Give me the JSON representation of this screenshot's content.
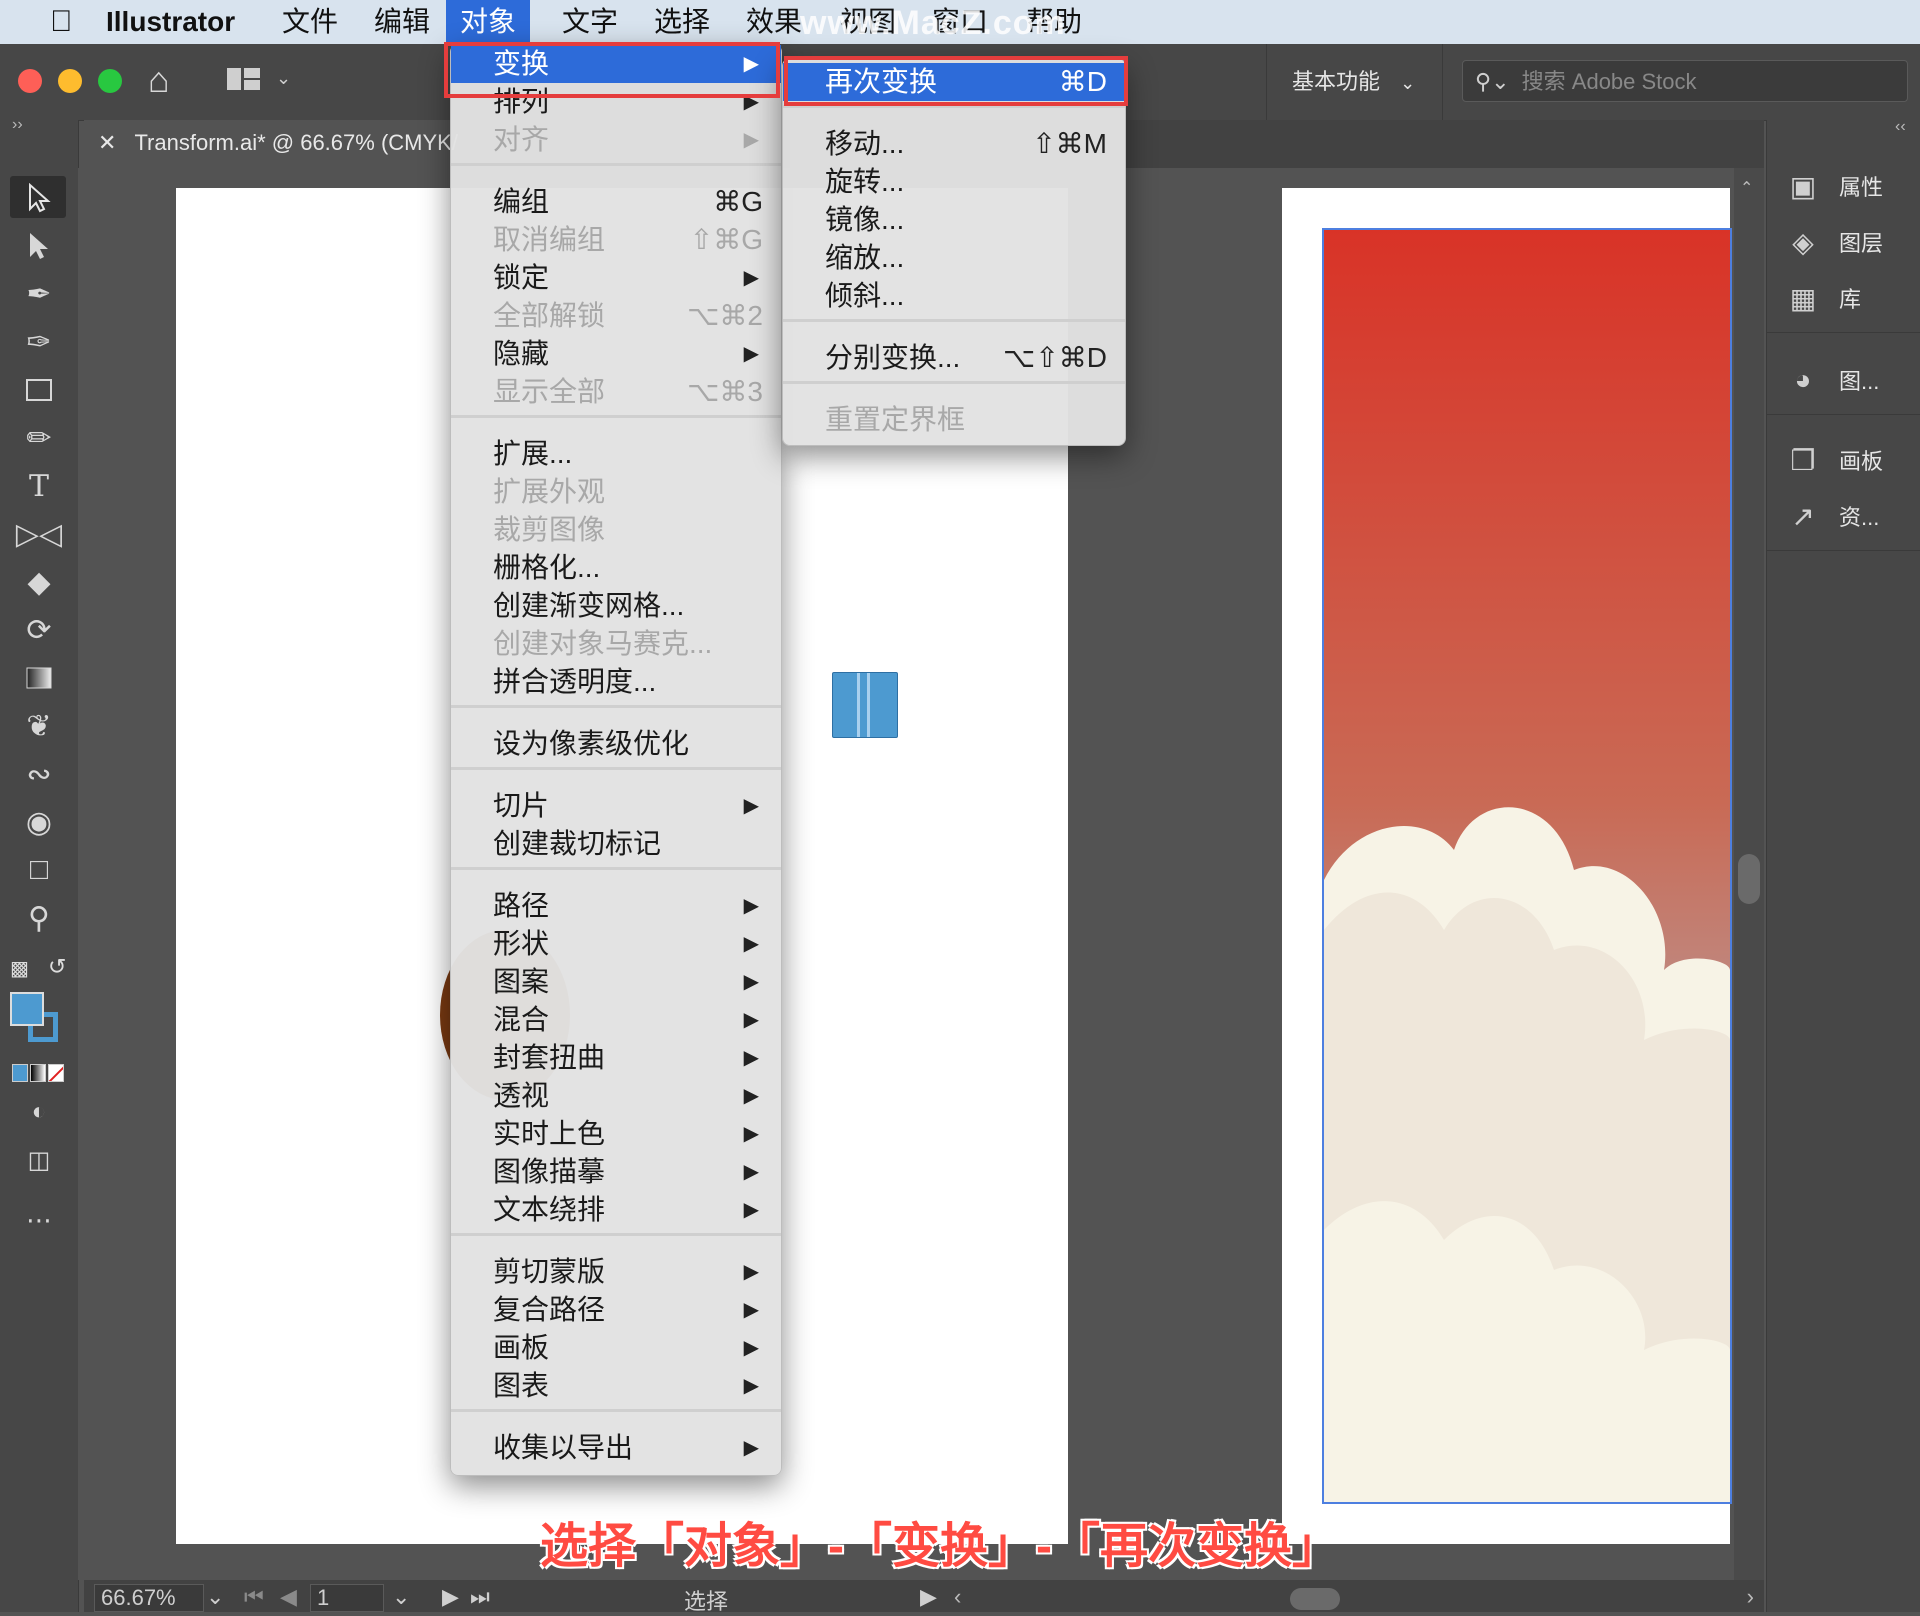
{
  "menubar": {
    "items": [
      "Illustrator",
      "文件",
      "编辑",
      "对象",
      "文字",
      "选择",
      "效果",
      "视图",
      "窗口",
      "帮助"
    ],
    "active": "对象"
  },
  "watermark": "www.MacZ.com",
  "controlbar": {
    "workspace": "基本功能",
    "search_placeholder": "搜索 Adobe Stock"
  },
  "tab": {
    "title": "Transform.ai* @ 66.67% (CMYK/"
  },
  "right_panel": {
    "items": [
      {
        "label": "属性",
        "icon": "properties-icon"
      },
      {
        "label": "图层",
        "icon": "layers-icon"
      },
      {
        "label": "库",
        "icon": "libraries-icon"
      },
      {
        "label": "图...",
        "icon": "appearance-icon"
      },
      {
        "label": "画板",
        "icon": "artboards-icon"
      },
      {
        "label": "资...",
        "icon": "asset-export-icon"
      }
    ]
  },
  "object_menu": {
    "items": [
      {
        "label": "变换",
        "shortcut": "",
        "submenu": true,
        "disabled": false,
        "highlighted": true
      },
      {
        "label": "排列",
        "shortcut": "",
        "submenu": true,
        "disabled": false
      },
      {
        "label": "对齐",
        "shortcut": "",
        "submenu": true,
        "disabled": true
      },
      {
        "sep": true
      },
      {
        "label": "编组",
        "shortcut": "⌘G",
        "submenu": false,
        "disabled": false
      },
      {
        "label": "取消编组",
        "shortcut": "⇧⌘G",
        "submenu": false,
        "disabled": true
      },
      {
        "label": "锁定",
        "shortcut": "",
        "submenu": true,
        "disabled": false
      },
      {
        "label": "全部解锁",
        "shortcut": "⌥⌘2",
        "submenu": false,
        "disabled": true
      },
      {
        "label": "隐藏",
        "shortcut": "",
        "submenu": true,
        "disabled": false
      },
      {
        "label": "显示全部",
        "shortcut": "⌥⌘3",
        "submenu": false,
        "disabled": true
      },
      {
        "sep": true
      },
      {
        "label": "扩展...",
        "shortcut": "",
        "submenu": false,
        "disabled": false
      },
      {
        "label": "扩展外观",
        "shortcut": "",
        "submenu": false,
        "disabled": true
      },
      {
        "label": "裁剪图像",
        "shortcut": "",
        "submenu": false,
        "disabled": true
      },
      {
        "label": "栅格化...",
        "shortcut": "",
        "submenu": false,
        "disabled": false
      },
      {
        "label": "创建渐变网格...",
        "shortcut": "",
        "submenu": false,
        "disabled": false
      },
      {
        "label": "创建对象马赛克...",
        "shortcut": "",
        "submenu": false,
        "disabled": true
      },
      {
        "label": "拼合透明度...",
        "shortcut": "",
        "submenu": false,
        "disabled": false
      },
      {
        "sep": true
      },
      {
        "label": "设为像素级优化",
        "shortcut": "",
        "submenu": false,
        "disabled": false
      },
      {
        "sep": true
      },
      {
        "label": "切片",
        "shortcut": "",
        "submenu": true,
        "disabled": false
      },
      {
        "label": "创建裁切标记",
        "shortcut": "",
        "submenu": false,
        "disabled": false
      },
      {
        "sep": true
      },
      {
        "label": "路径",
        "shortcut": "",
        "submenu": true,
        "disabled": false
      },
      {
        "label": "形状",
        "shortcut": "",
        "submenu": true,
        "disabled": false
      },
      {
        "label": "图案",
        "shortcut": "",
        "submenu": true,
        "disabled": false
      },
      {
        "label": "混合",
        "shortcut": "",
        "submenu": true,
        "disabled": false
      },
      {
        "label": "封套扭曲",
        "shortcut": "",
        "submenu": true,
        "disabled": false
      },
      {
        "label": "透视",
        "shortcut": "",
        "submenu": true,
        "disabled": false
      },
      {
        "label": "实时上色",
        "shortcut": "",
        "submenu": true,
        "disabled": false
      },
      {
        "label": "图像描摹",
        "shortcut": "",
        "submenu": true,
        "disabled": false
      },
      {
        "label": "文本绕排",
        "shortcut": "",
        "submenu": true,
        "disabled": false
      },
      {
        "sep": true
      },
      {
        "label": "剪切蒙版",
        "shortcut": "",
        "submenu": true,
        "disabled": false
      },
      {
        "label": "复合路径",
        "shortcut": "",
        "submenu": true,
        "disabled": false
      },
      {
        "label": "画板",
        "shortcut": "",
        "submenu": true,
        "disabled": false
      },
      {
        "label": "图表",
        "shortcut": "",
        "submenu": true,
        "disabled": false
      },
      {
        "sep": true
      },
      {
        "label": "收集以导出",
        "shortcut": "",
        "submenu": true,
        "disabled": false
      }
    ]
  },
  "transform_menu": {
    "items": [
      {
        "label": "再次变换",
        "shortcut": "⌘D",
        "disabled": false,
        "highlighted": true
      },
      {
        "sep": true
      },
      {
        "label": "移动...",
        "shortcut": "⇧⌘M",
        "disabled": false
      },
      {
        "label": "旋转...",
        "shortcut": "",
        "disabled": false
      },
      {
        "label": "镜像...",
        "shortcut": "",
        "disabled": false
      },
      {
        "label": "缩放...",
        "shortcut": "",
        "disabled": false
      },
      {
        "label": "倾斜...",
        "shortcut": "",
        "disabled": false
      },
      {
        "sep": true
      },
      {
        "label": "分别变换...",
        "shortcut": "⌥⇧⌘D",
        "disabled": false
      },
      {
        "sep": true
      },
      {
        "label": "重置定界框",
        "shortcut": "",
        "disabled": true
      }
    ]
  },
  "statusbar": {
    "zoom": "66.67%",
    "artboard": "1",
    "tool": "选择"
  },
  "caption": "选择「对象」-「变换」-「再次变换」",
  "colors": {
    "accent": "#2d6bd9",
    "highlight_box": "#e53d3d",
    "fill": "#4d9ad0"
  }
}
